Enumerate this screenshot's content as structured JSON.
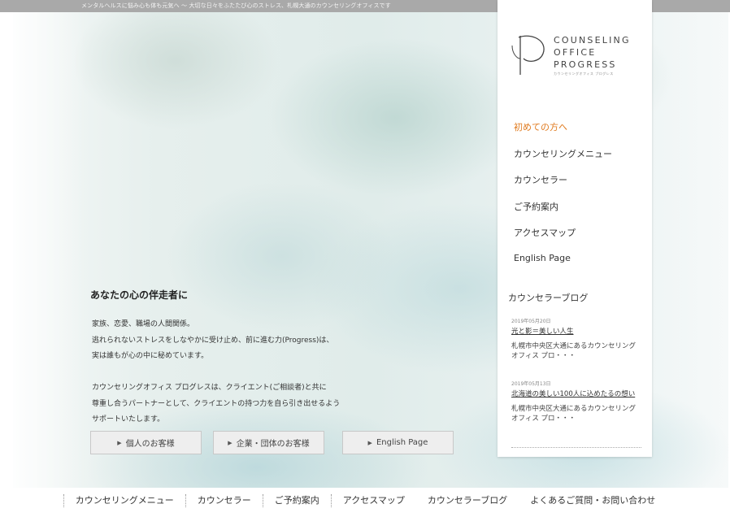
{
  "topbar": {
    "tagline": "メンタルヘルスに悩み心も体も元気へ ～ 大切な日々をふたたび心のストレス、札幌大通のカウンセリングオフィスです"
  },
  "hero": {
    "catchphrase": "あなたの心の伴走者に",
    "intro_lines": [
      "家族、恋愛、職場の人間関係。",
      "逃れられないストレスをしなやかに受け止め、前に進む力(Progress)は、",
      "実は誰もが心の中に秘めています。",
      "",
      "カウンセリングオフィス プログレスは、クライエント(ご相談者)と共に",
      "尊重し合うパートナーとして、クライエントの持つ力を自ら引き出せるよう",
      "サポートいたします。"
    ],
    "buttons": {
      "individual": "個人のお客様",
      "corporate": "企業・団体のお客様",
      "english": "English Page"
    }
  },
  "sidebar": {
    "logo": {
      "line1": "COUNSELING",
      "line2": "OFFICE",
      "line3": "PROGRESS",
      "sub": "カウンセリングオフィス プログレス"
    },
    "nav": [
      "初めての方へ",
      "カウンセリングメニュー",
      "カウンセラー",
      "ご予約案内",
      "アクセスマップ",
      "English Page"
    ],
    "blog": {
      "heading": "カウンセラーブログ",
      "posts": [
        {
          "date": "2019年05月20日",
          "title": "光と影＝美しい人生",
          "excerpt": "札幌市中央区大通にあるカウンセリングオフィス プロ・・・"
        },
        {
          "date": "2019年05月13日",
          "title": "北海道の美しい100人に込めたるの想い",
          "excerpt": "札幌市中央区大通にあるカウンセリングオフィス プロ・・・"
        }
      ]
    }
  },
  "footer": {
    "links": [
      "カウンセリングメニュー",
      "カウンセラー",
      "ご予約案内",
      "アクセスマップ",
      "カウンセラーブログ",
      "よくあるご質問・お問い合わせ"
    ]
  },
  "colors": {
    "accent": "#e07a1e",
    "topbar": "#a9a9a9"
  }
}
